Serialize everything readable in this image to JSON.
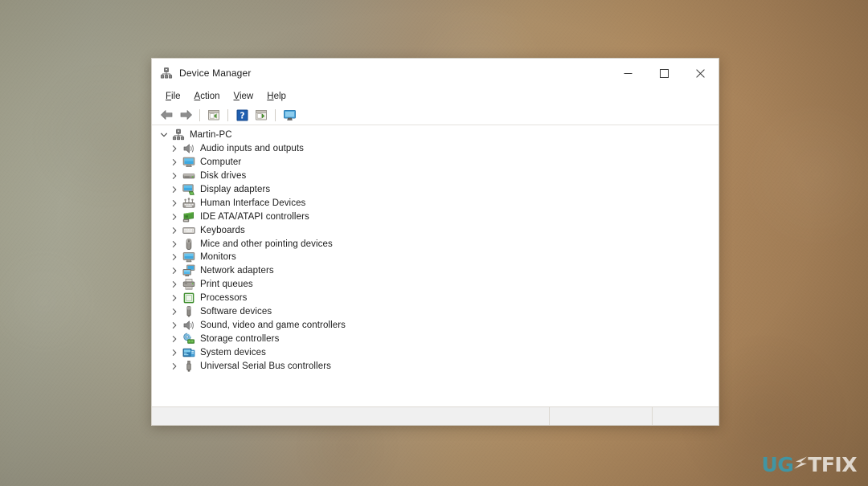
{
  "window": {
    "title": "Device Manager",
    "title_icon": "device-manager-icon",
    "controls": {
      "minimize": "minimize-icon",
      "maximize": "maximize-icon",
      "close": "close-icon"
    }
  },
  "menubar": {
    "items": [
      {
        "accesskey": "F",
        "rest": "ile",
        "name": "menu-file"
      },
      {
        "accesskey": "A",
        "rest": "ction",
        "name": "menu-action"
      },
      {
        "accesskey": "V",
        "rest": "iew",
        "name": "menu-view"
      },
      {
        "accesskey": "H",
        "rest": "elp",
        "name": "menu-help"
      }
    ]
  },
  "toolbar": {
    "buttons": [
      {
        "name": "back-arrow-icon",
        "icon": "back-arrow"
      },
      {
        "name": "forward-arrow-icon",
        "icon": "forward-arrow"
      },
      {
        "name": "toolbar-separator-1",
        "icon": "separator"
      },
      {
        "name": "properties-icon",
        "icon": "window-left-arrow"
      },
      {
        "name": "toolbar-separator-2",
        "icon": "separator"
      },
      {
        "name": "help-icon",
        "icon": "question-mark"
      },
      {
        "name": "update-driver-icon",
        "icon": "window-right-arrow"
      },
      {
        "name": "toolbar-separator-3",
        "icon": "separator"
      },
      {
        "name": "scan-hardware-changes-icon",
        "icon": "monitor-scan"
      }
    ]
  },
  "tree": {
    "root": {
      "label": "Martin-PC",
      "icon": "computer-network-icon",
      "expanded": true
    },
    "items": [
      {
        "label": "Audio inputs and outputs",
        "icon": "speaker-icon"
      },
      {
        "label": "Computer",
        "icon": "computer-icon"
      },
      {
        "label": "Disk drives",
        "icon": "disk-drive-icon"
      },
      {
        "label": "Display adapters",
        "icon": "display-adapter-icon"
      },
      {
        "label": "Human Interface Devices",
        "icon": "hid-icon"
      },
      {
        "label": "IDE ATA/ATAPI controllers",
        "icon": "ide-controller-icon"
      },
      {
        "label": "Keyboards",
        "icon": "keyboard-icon"
      },
      {
        "label": "Mice and other pointing devices",
        "icon": "mouse-icon"
      },
      {
        "label": "Monitors",
        "icon": "monitor-icon"
      },
      {
        "label": "Network adapters",
        "icon": "network-adapter-icon"
      },
      {
        "label": "Print queues",
        "icon": "printer-icon"
      },
      {
        "label": "Processors",
        "icon": "processor-icon"
      },
      {
        "label": "Software devices",
        "icon": "software-device-icon"
      },
      {
        "label": "Sound, video and game controllers",
        "icon": "sound-controller-icon"
      },
      {
        "label": "Storage controllers",
        "icon": "storage-controller-icon"
      },
      {
        "label": "System devices",
        "icon": "system-device-icon"
      },
      {
        "label": "Universal Serial Bus controllers",
        "icon": "usb-controller-icon"
      }
    ]
  },
  "statusbar": {
    "main_text": "",
    "cell_a_text": "",
    "cell_b_text": ""
  },
  "watermark": {
    "part1": "UG",
    "part2": "TFIX",
    "color_primary": "#3d98a8",
    "color_secondary": "#e9e4dc"
  },
  "colors": {
    "window_bg": "#ffffff",
    "statusbar_bg": "#f0f0f0",
    "accent_blue": "#0078d7",
    "desktop_left": "#a8a894",
    "desktop_right": "#96744e"
  }
}
